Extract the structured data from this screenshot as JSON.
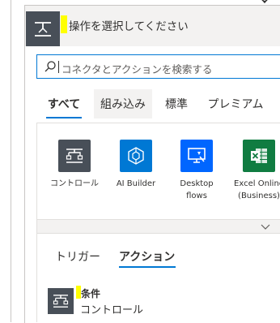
{
  "header": {
    "title": "操作を選択してください"
  },
  "search": {
    "placeholder": "コネクタとアクションを検索する"
  },
  "tabs": [
    {
      "label": "すべて",
      "selected": true
    },
    {
      "label": "組み込み",
      "selected": false
    },
    {
      "label": "標準",
      "selected": false
    },
    {
      "label": "プレミアム",
      "selected": false
    }
  ],
  "connectors": [
    {
      "label": "コントロール",
      "label2": "",
      "icon": "control-icon",
      "color": "#484f58"
    },
    {
      "label": "AI Builder",
      "label2": "",
      "icon": "ai-builder-icon",
      "color": "#0078d4"
    },
    {
      "label": "Desktop",
      "label2": "flows",
      "icon": "desktop-flows-icon",
      "color": "#0066ff"
    },
    {
      "label": "Excel Online",
      "label2": "(Business)",
      "icon": "excel-icon",
      "color": "#107c41"
    }
  ],
  "sub_tabs": [
    {
      "label": "トリガー",
      "selected": false
    },
    {
      "label": "アクション",
      "selected": true
    }
  ],
  "actions": [
    {
      "title": "条件",
      "subtitle": "コントロール",
      "icon": "control-icon"
    }
  ],
  "colors": {
    "accent": "#0078d4",
    "highlight": "#ffff00",
    "control_tile": "#484f58"
  }
}
